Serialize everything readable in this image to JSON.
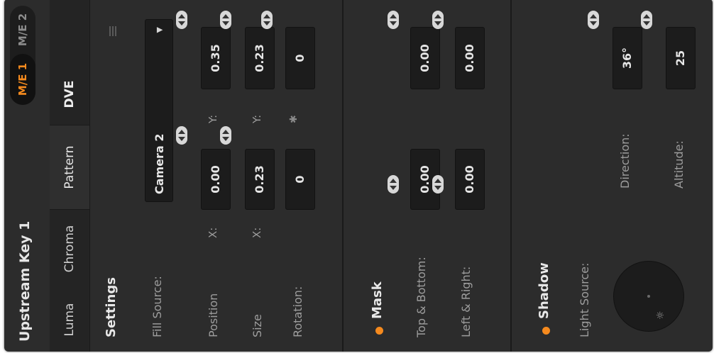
{
  "header": {
    "title": "Upstream Key 1",
    "me_buttons": [
      "M/E 1",
      "M/E 2"
    ],
    "active_me": "M/E 1",
    "accent_color": "#f58a1e"
  },
  "tabs": [
    {
      "label": "Luma"
    },
    {
      "label": "Chroma"
    },
    {
      "label": "Pattern"
    },
    {
      "label": "DVE"
    }
  ],
  "settings": {
    "title": "Settings",
    "fill_source": {
      "label": "Fill Source:",
      "value": "Camera 2"
    },
    "position": {
      "label": "Position",
      "x_label": "X:",
      "x": "0.00",
      "y_label": "Y:",
      "y": "0.35"
    },
    "size": {
      "label": "Size",
      "x_label": "X:",
      "x": "0.23",
      "y_label": "Y:",
      "y": "0.23"
    },
    "rotation": {
      "label": "Rotation:",
      "value": "0",
      "value2": "0"
    }
  },
  "mask": {
    "title": "Mask",
    "top_bottom": {
      "label": "Top & Bottom:",
      "a": "0.00",
      "b": "0.00"
    },
    "left_right": {
      "label": "Left & Right:",
      "a": "0.00",
      "b": "0.00"
    }
  },
  "shadow": {
    "title": "Shadow",
    "light_source": {
      "label": "Light Source:"
    },
    "direction": {
      "label": "Direction:",
      "value": "36°"
    },
    "altitude": {
      "label": "Altitude:",
      "value": "25"
    }
  }
}
